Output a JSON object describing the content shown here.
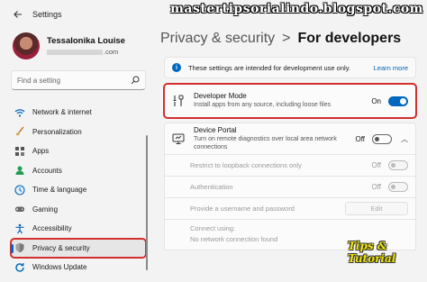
{
  "window": {
    "title": "Settings",
    "back_icon": "back-arrow-icon"
  },
  "watermark": {
    "top": "mastertipsorialindo.blogspot.com",
    "bottom": "Tips & Tutorial"
  },
  "profile": {
    "name": "Tessalonika Louise",
    "email_suffix": ".com"
  },
  "search": {
    "placeholder": "Find a setting",
    "icon": "search-icon"
  },
  "sidebar": {
    "items": [
      {
        "label": "Network & internet",
        "icon": "wifi-icon",
        "color": "#0067c0"
      },
      {
        "label": "Personalization",
        "icon": "paintbrush-icon",
        "color": "#c0803a"
      },
      {
        "label": "Apps",
        "icon": "apps-icon",
        "color": "#3a3a3a"
      },
      {
        "label": "Accounts",
        "icon": "person-icon",
        "color": "#1f9e55"
      },
      {
        "label": "Time & language",
        "icon": "globe-clock-icon",
        "color": "#0067c0"
      },
      {
        "label": "Gaming",
        "icon": "gamepad-icon",
        "color": "#555555"
      },
      {
        "label": "Accessibility",
        "icon": "accessibility-icon",
        "color": "#0067c0"
      },
      {
        "label": "Privacy & security",
        "icon": "shield-icon",
        "color": "#666666",
        "active": true
      },
      {
        "label": "Windows Update",
        "icon": "update-icon",
        "color": "#0067c0"
      }
    ]
  },
  "breadcrumb": {
    "parent": "Privacy & security",
    "separator": ">",
    "current": "For developers"
  },
  "info": {
    "text": "These settings are intended for development use only.",
    "link": "Learn more"
  },
  "developer_mode": {
    "title": "Developer Mode",
    "description": "Install apps from any source, including loose files",
    "state_label": "On",
    "enabled": true
  },
  "device_portal": {
    "title": "Device Portal",
    "description": "Turn on remote diagnostics over local area network connections",
    "state_label": "Off",
    "enabled": false,
    "expanded": true,
    "options": {
      "loopback": {
        "label": "Restrict to loopback connections only",
        "state_label": "Off"
      },
      "auth": {
        "label": "Authentication",
        "state_label": "Off"
      },
      "credentials": {
        "label": "Provide a username and password",
        "button": "Edit"
      },
      "connect": {
        "label": "Connect using:",
        "value": "No network connection found"
      }
    }
  },
  "accent": "#0067c0",
  "highlight": "#d32f2f"
}
